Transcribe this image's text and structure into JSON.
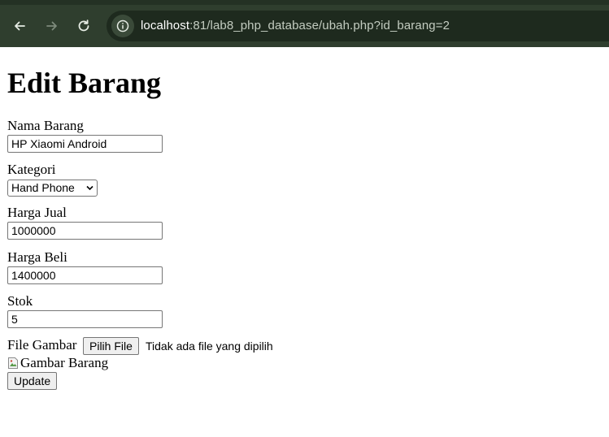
{
  "browser": {
    "url_host": "localhost",
    "url_rest": ":81/lab8_php_database/ubah.php?id_barang=2",
    "icons": {
      "back": "arrow-left-icon",
      "forward": "arrow-right-icon",
      "reload": "reload-icon",
      "site_info": "info-icon"
    }
  },
  "page": {
    "title": "Edit Barang",
    "form": {
      "nama_barang": {
        "label": "Nama Barang",
        "value": "HP Xiaomi Android"
      },
      "kategori": {
        "label": "Kategori",
        "selected": "Hand Phone"
      },
      "harga_jual": {
        "label": "Harga Jual",
        "value": "1000000"
      },
      "harga_beli": {
        "label": "Harga Beli",
        "value": "1400000"
      },
      "stok": {
        "label": "Stok",
        "value": "5"
      },
      "file_gambar": {
        "label": "File Gambar",
        "button_label": "Pilih File",
        "status": "Tidak ada file yang dipilih"
      },
      "image_alt": "Gambar Barang",
      "submit_label": "Update"
    }
  },
  "colors": {
    "toolbar_bg": "#2f3e2e",
    "addressbar_bg": "#1e2a1e"
  }
}
